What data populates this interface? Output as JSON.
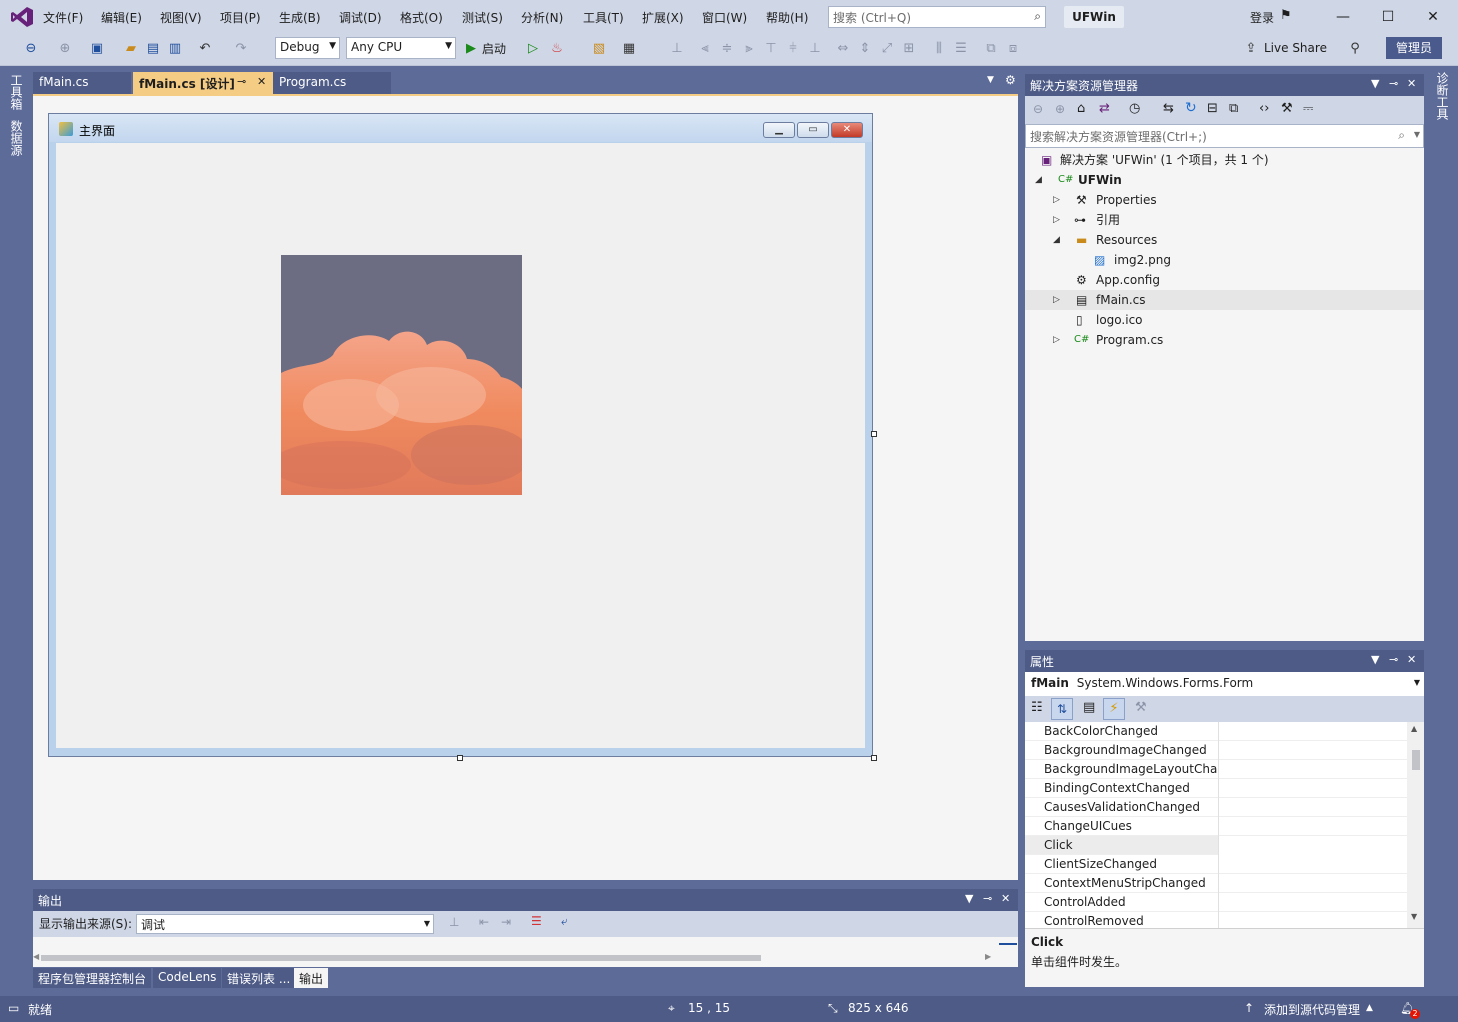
{
  "menu": [
    "文件(F)",
    "编辑(E)",
    "视图(V)",
    "项目(P)",
    "生成(B)",
    "调试(D)",
    "格式(O)",
    "测试(S)",
    "分析(N)",
    "工具(T)",
    "扩展(X)",
    "窗口(W)",
    "帮助(H)"
  ],
  "search": {
    "placeholder": "搜索 (Ctrl+Q)"
  },
  "app_title": "UFWin",
  "signin": "登录",
  "toolbar": {
    "config": "Debug",
    "platform": "Any CPU",
    "start": "启动",
    "live_share": "Live Share",
    "admin": "管理员"
  },
  "left_rail": [
    "工具箱",
    "数据源"
  ],
  "right_rail": [
    "诊断工具"
  ],
  "doc_tabs": [
    {
      "label": "fMain.cs"
    },
    {
      "label": "fMain.cs [设计]",
      "pin": "⊸"
    },
    {
      "label": "Program.cs"
    }
  ],
  "form": {
    "title": "主界面"
  },
  "solution_explorer": {
    "title": "解决方案资源管理器",
    "search_placeholder": "搜索解决方案资源管理器(Ctrl+;)",
    "items": [
      {
        "label": "解决方案 'UFWin' (1 个项目，共 1 个)",
        "icon": "solution-icon"
      },
      {
        "label": "UFWin",
        "icon": "csharp-project-icon"
      },
      {
        "label": "Properties",
        "icon": "wrench-icon"
      },
      {
        "label": "引用",
        "icon": "references-icon"
      },
      {
        "label": "Resources",
        "icon": "folder-icon"
      },
      {
        "label": "img2.png",
        "icon": "image-icon"
      },
      {
        "label": "App.config",
        "icon": "config-icon"
      },
      {
        "label": "fMain.cs",
        "icon": "form-icon"
      },
      {
        "label": "logo.ico",
        "icon": "ico-file-icon"
      },
      {
        "label": "Program.cs",
        "icon": "csharp-file-icon"
      }
    ]
  },
  "properties": {
    "title": "属性",
    "object_name": "fMain",
    "object_type": "System.Windows.Forms.Form",
    "events": [
      "BackColorChanged",
      "BackgroundImageChanged",
      "BackgroundImageLayoutChar",
      "BindingContextChanged",
      "CausesValidationChanged",
      "ChangeUICues",
      "Click",
      "ClientSizeChanged",
      "ContextMenuStripChanged",
      "ControlAdded",
      "ControlRemoved"
    ],
    "selected_event": "Click",
    "description_title": "Click",
    "description_text": "单击组件时发生。"
  },
  "output": {
    "title": "输出",
    "source_label": "显示输出来源(S):",
    "source_value": "调试"
  },
  "bottom_tabs": [
    "程序包管理器控制台",
    "CodeLens",
    "错误列表 ...",
    "输出"
  ],
  "status": {
    "ready": "就绪",
    "position": "15 , 15",
    "size": "825 x 646",
    "source_control": "添加到源代码管理",
    "notifications": "2"
  },
  "colors": {
    "accent": "#5d6b99",
    "tab_active": "#f5cc84",
    "admin": "#4a5a8c"
  }
}
